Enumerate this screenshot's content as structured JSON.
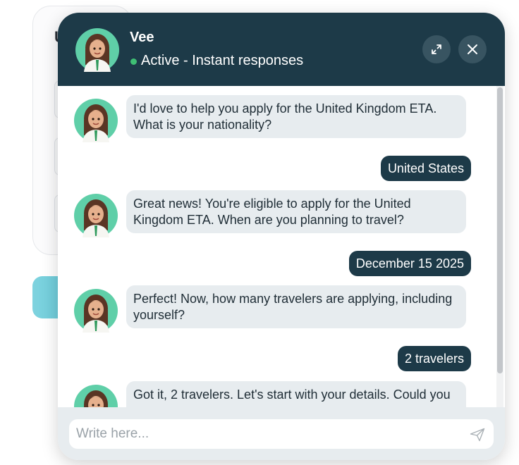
{
  "background": {
    "letter": "U"
  },
  "chat": {
    "agent_name": "Vee",
    "status": "Active - Instant responses",
    "expand_icon": "expand-icon",
    "close_icon": "close-icon",
    "messages": [
      {
        "from": "bot",
        "text": "I'd love to help you apply for the United Kingdom ETA. What is your nationality?"
      },
      {
        "from": "user",
        "text": "United States"
      },
      {
        "from": "bot",
        "text": "Great news! You're eligible to apply for the United Kingdom ETA. When are you planning to travel?"
      },
      {
        "from": "user",
        "text": "December 15 2025"
      },
      {
        "from": "bot",
        "text": "Perfect! Now, how many travelers are applying, including yourself?"
      },
      {
        "from": "user",
        "text": "2 travelers"
      },
      {
        "from": "bot",
        "text": "Got it, 2 travelers. Let's start with your details. Could you"
      }
    ],
    "input_placeholder": "Write here...",
    "send_icon": "send-icon"
  },
  "colors": {
    "header": "#1d3a48",
    "bot_bubble": "#e7ecef",
    "user_bubble": "#1d3a48",
    "status": "#3fbf74"
  }
}
